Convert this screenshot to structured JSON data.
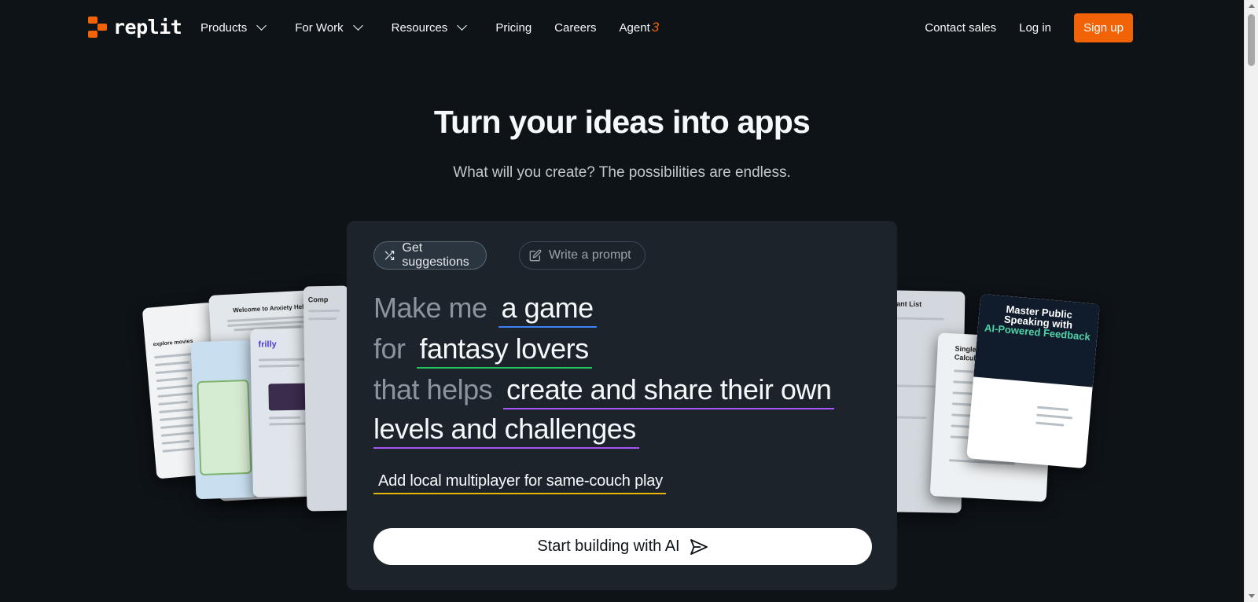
{
  "nav": {
    "logo_text": "replit",
    "items": [
      {
        "label": "Products",
        "dropdown": true
      },
      {
        "label": "For Work",
        "dropdown": true
      },
      {
        "label": "Resources",
        "dropdown": true
      },
      {
        "label": "Pricing",
        "dropdown": false
      },
      {
        "label": "Careers",
        "dropdown": false
      }
    ],
    "agent_label": "Agent",
    "agent_badge": "3",
    "contact_sales": "Contact sales",
    "login": "Log in",
    "signup": "Sign up"
  },
  "hero": {
    "title": "Turn your ideas into apps",
    "subtitle": "What will you create? The possibilities are endless."
  },
  "cards": {
    "c1_header": "explore movies",
    "c2_header": "Welcome to Anxiety Helper",
    "c4_header": "frilly",
    "c5_header": "Comp",
    "c6_header": "grant List",
    "c7_header": "Single Property Loan Calculator",
    "c8_title_1": "Master Public Speaking with",
    "c8_title_2": "AI-Powered Feedback"
  },
  "prompt": {
    "tab_suggestions": "Get suggestions",
    "tab_write": "Write a prompt",
    "line1_prefix": "Make me",
    "line1_value": "a game",
    "line2_prefix": "for",
    "line2_value": "fantasy lovers",
    "line3_prefix": "that helps",
    "line3_value": "create and share their own",
    "line4_value": "levels and challenges",
    "addon": "Add local multiplayer for same-couch play",
    "cta": "Start building with AI"
  },
  "colors": {
    "brand_orange": "#f26207",
    "underline_blue": "#3b82f6",
    "underline_green": "#22c55e",
    "underline_purple": "#a855f7",
    "underline_yellow": "#eab308",
    "background": "#0e1318",
    "panel": "#1c232b"
  },
  "icons": {
    "shuffle": "shuffle-icon",
    "edit": "edit-icon",
    "send": "send-icon",
    "chevron": "chevron-down-icon"
  }
}
